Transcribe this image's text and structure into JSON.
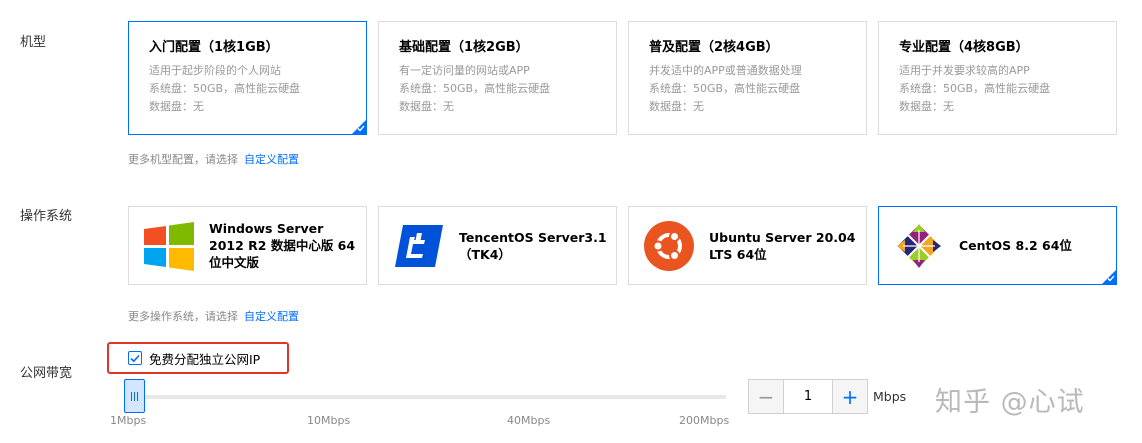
{
  "model_section": {
    "label": "机型",
    "cards": [
      {
        "title": "入门配置（1核1GB）",
        "desc": "适用于起步阶段的个人网站",
        "system_disk": "系统盘：50GB，高性能云硬盘",
        "data_disk": "数据盘：无",
        "selected": true
      },
      {
        "title": "基础配置（1核2GB）",
        "desc": "有一定访问量的网站或APP",
        "system_disk": "系统盘：50GB，高性能云硬盘",
        "data_disk": "数据盘：无",
        "selected": false
      },
      {
        "title": "普及配置（2核4GB）",
        "desc": "并发适中的APP或普通数据处理",
        "system_disk": "系统盘：50GB，高性能云硬盘",
        "data_disk": "数据盘：无",
        "selected": false
      },
      {
        "title": "专业配置（4核8GB）",
        "desc": "适用于并发要求较高的APP",
        "system_disk": "系统盘：50GB，高性能云硬盘",
        "data_disk": "数据盘：无",
        "selected": false
      }
    ],
    "hint": "更多机型配置，请选择",
    "hint_link": "自定义配置"
  },
  "os_section": {
    "label": "操作系统",
    "cards": [
      {
        "name": "Windows Server 2012 R2 数据中心版 64位中文版",
        "icon": "windows-icon",
        "selected": false
      },
      {
        "name": "TencentOS Server3.1（TK4）",
        "icon": "tencentos-icon",
        "selected": false
      },
      {
        "name": "Ubuntu Server 20.04 LTS 64位",
        "icon": "ubuntu-icon",
        "selected": false
      },
      {
        "name": "CentOS 8.2 64位",
        "icon": "centos-icon",
        "selected": true
      }
    ],
    "hint": "更多操作系统，请选择",
    "hint_link": "自定义配置"
  },
  "bandwidth_section": {
    "label": "公网带宽",
    "free_ip_label": "免费分配独立公网IP",
    "free_ip_checked": true,
    "ticks": [
      "1Mbps",
      "10Mbps",
      "40Mbps",
      "200Mbps"
    ],
    "value": "1",
    "unit": "Mbps",
    "minus": "−",
    "plus": "+"
  },
  "watermark": "知乎 @心试",
  "colors": {
    "accent": "#006eff",
    "highlight_box": "#e2342b"
  }
}
